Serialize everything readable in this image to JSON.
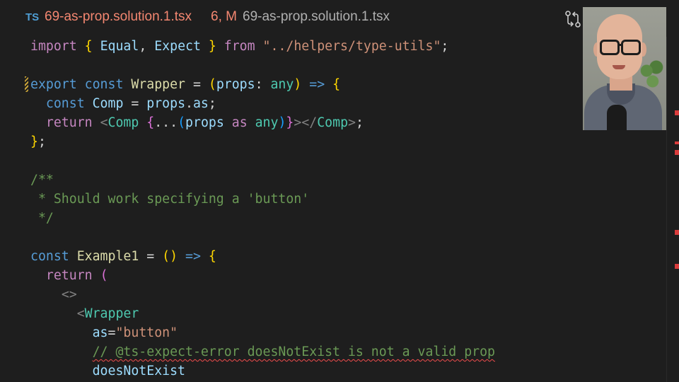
{
  "tab": {
    "lang_badge": "TS",
    "filename": "69-as-prop.solution.1.tsx",
    "status": "6, M",
    "breadcrumb": "69-as-prop.solution.1.tsx"
  },
  "icons": {
    "diff": "git-compare-icon"
  },
  "code": {
    "l1": {
      "t1": "import",
      "t2": "{",
      "t3": "Equal",
      "t4": ",",
      "t5": "Expect",
      "t6": "}",
      "t7": "from",
      "t8": "\"../helpers/type-utils\"",
      "t9": ";"
    },
    "l3": {
      "t1": "export",
      "t2": "const",
      "t3": "Wrapper",
      "t4": "=",
      "t5": "(",
      "t6": "props",
      "t7": ":",
      "t8": "any",
      "t9": ")",
      "t10": "=>",
      "t11": "{"
    },
    "l4": {
      "t1": "const",
      "t2": "Comp",
      "t3": "=",
      "t4": "props",
      "t5": ".",
      "t6": "as",
      "t7": ";"
    },
    "l5": {
      "t1": "return",
      "t2": "<",
      "t3": "Comp",
      "t4": "{",
      "t5": "...",
      "t6": "(",
      "t7": "props",
      "t8": "as",
      "t9": "any",
      "t10": ")",
      "t11": "}",
      "t12": "></",
      "t13": "Comp",
      "t14": ">",
      "t15": ";"
    },
    "l6": {
      "t1": "}",
      "t2": ";"
    },
    "l8": "/**",
    "l9": " * Should work specifying a 'button'",
    "l10": " */",
    "l12": {
      "t1": "const",
      "t2": "Example1",
      "t3": "=",
      "t4": "()",
      "t5": "=>",
      "t6": "{"
    },
    "l13": {
      "t1": "return",
      "t2": "("
    },
    "l14": "<>",
    "l15": {
      "t1": "<",
      "t2": "Wrapper"
    },
    "l16": {
      "t1": "as",
      "t2": "=",
      "t3": "\"button\""
    },
    "l17": "// @ts-expect-error doesNotExist is not a valid prop",
    "l18": "doesNotExist"
  },
  "colors": {
    "background": "#1e1e1e",
    "keyword": "#569cd6",
    "error": "#f48771",
    "comment": "#6a9955"
  }
}
